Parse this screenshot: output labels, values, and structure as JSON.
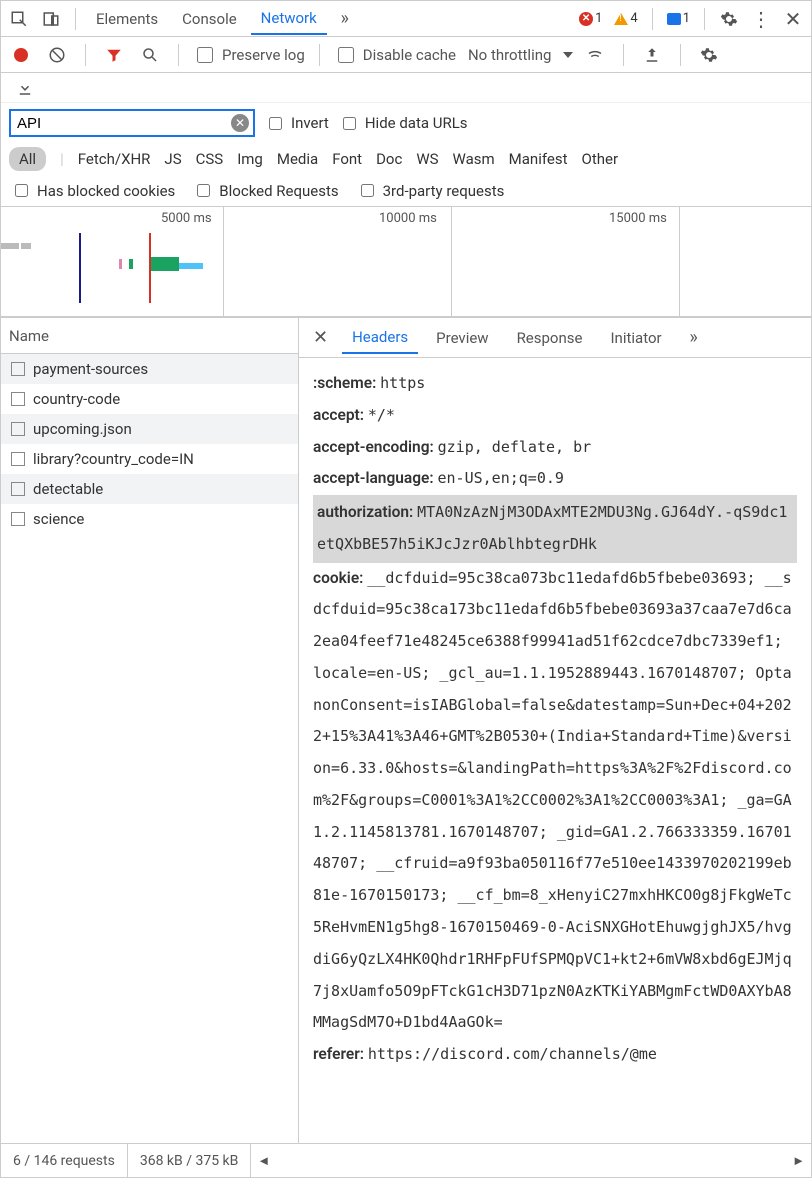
{
  "topTabs": {
    "elements": "Elements",
    "console": "Console",
    "network": "Network"
  },
  "badges": {
    "errors": "1",
    "warnings": "4",
    "messages": "1"
  },
  "toolbar": {
    "preserveLog": "Preserve log",
    "disableCache": "Disable cache",
    "throttling": "No throttling"
  },
  "filterRow": {
    "filterValue": "API",
    "invert": "Invert",
    "hideData": "Hide data URLs"
  },
  "typeFilters": {
    "all": "All",
    "fetch": "Fetch/XHR",
    "js": "JS",
    "css": "CSS",
    "img": "Img",
    "media": "Media",
    "font": "Font",
    "doc": "Doc",
    "ws": "WS",
    "wasm": "Wasm",
    "manifest": "Manifest",
    "other": "Other"
  },
  "extraFilters": {
    "blockedCookies": "Has blocked cookies",
    "blockedRequests": "Blocked Requests",
    "thirdParty": "3rd-party requests"
  },
  "timeline": {
    "t1": "5000 ms",
    "t2": "10000 ms",
    "t3": "15000 ms"
  },
  "leftHeader": "Name",
  "requests": [
    {
      "name": "payment-sources"
    },
    {
      "name": "country-code"
    },
    {
      "name": "upcoming.json"
    },
    {
      "name": "library?country_code=IN"
    },
    {
      "name": "detectable"
    },
    {
      "name": "science"
    }
  ],
  "rightTabs": {
    "headers": "Headers",
    "preview": "Preview",
    "response": "Response",
    "initiator": "Initiator"
  },
  "headers": {
    "scheme_k": ":scheme:",
    "scheme_v": "https",
    "accept_k": "accept:",
    "accept_v": "*/*",
    "ae_k": "accept-encoding:",
    "ae_v": "gzip, deflate, br",
    "al_k": "accept-language:",
    "al_v": "en-US,en;q=0.9",
    "auth_k": "authorization:",
    "auth_v": "MTA0NzAzNjM3ODAxMTE2MDU3Ng.GJ64dY.-qS9dc1etQXbBE57h5iKJcJzr0AblhbtegrDHk",
    "cookie_k": "cookie:",
    "cookie_v": "__dcfduid=95c38ca073bc11edafd6b5fbebe03693; __sdcfduid=95c38ca173bc11edafd6b5fbebe03693a37caa7e7d6ca2ea04feef71e48245ce6388f99941ad51f62cdce7dbc7339ef1; locale=en-US; _gcl_au=1.1.1952889443.1670148707; OptanonConsent=isIABGlobal=false&datestamp=Sun+Dec+04+2022+15%3A41%3A46+GMT%2B0530+(India+Standard+Time)&version=6.33.0&hosts=&landingPath=https%3A%2F%2Fdiscord.com%2F&groups=C0001%3A1%2CC0002%3A1%2CC0003%3A1; _ga=GA1.2.1145813781.1670148707; _gid=GA1.2.766333359.1670148707; __cfruid=a9f93ba050116f77e510ee1433970202199eb81e-1670150173; __cf_bm=8_xHenyiC27mxhHKCO0g8jFkgWeTc5ReHvmEN1g5hg8-1670150469-0-AciSNXGHotEhuwgjghJX5/hvgdiG6yQzLX4HK0Qhdr1RHFpFUfSPMQpVC1+kt2+6mVW8xbd6gEJMjq7j8xUamfo5O9pFTckG1cH3D71pzN0AzKTKiYABMgmFctWD0AXYbA8MMagSdM7O+D1bd4AaGOk=",
    "referer_k": "referer:",
    "referer_v": "https://discord.com/channels/@me"
  },
  "status": {
    "requests": "6 / 146 requests",
    "size": "368 kB / 375 kB"
  }
}
